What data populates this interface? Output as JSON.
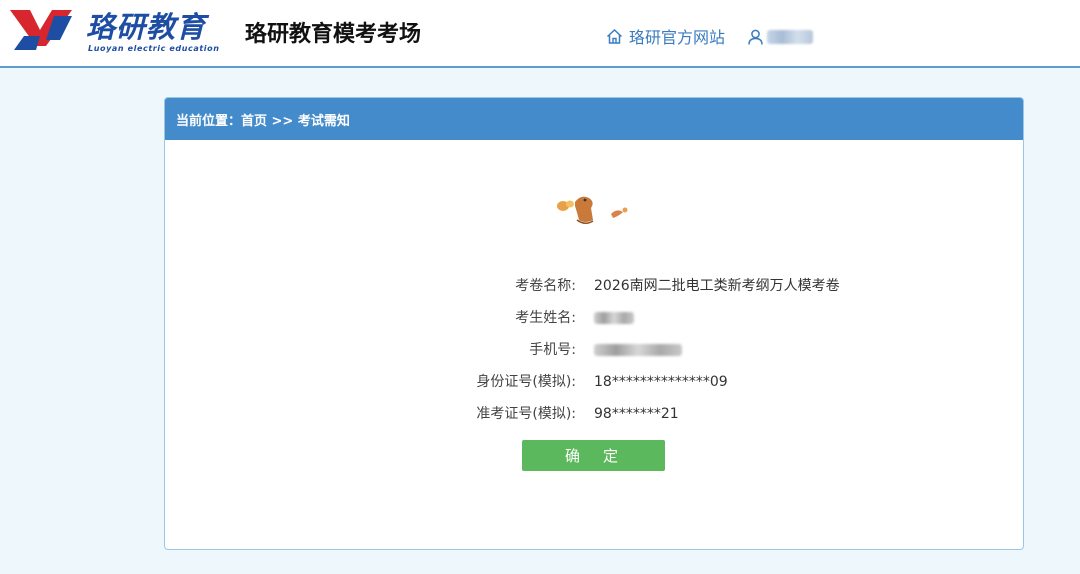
{
  "header": {
    "logo_text": "珞研教育",
    "logo_subtext": "Luoyan electric education",
    "site_title": "珞研教育模考考场",
    "home_link": "珞研官方网站",
    "user_icon": "user-icon",
    "home_icon": "home-icon",
    "brand_color": "#1d4ea3",
    "accent_color": "#438bca"
  },
  "breadcrumb": {
    "text": "当前位置：首页 >> 考试需知"
  },
  "exam_info": {
    "paper_name_label": "考卷名称:",
    "paper_name": "2026南网二批电工类新考纲万人模考卷",
    "examinee_label": "考生姓名:",
    "phone_label": "手机号:",
    "id_label": "身份证号(模拟):",
    "id_value": "18**************09",
    "ticket_label": "准考证号(模拟):",
    "ticket_value": "98*******21"
  },
  "confirm_button": {
    "label": "确　定",
    "color": "#5cb85c"
  }
}
